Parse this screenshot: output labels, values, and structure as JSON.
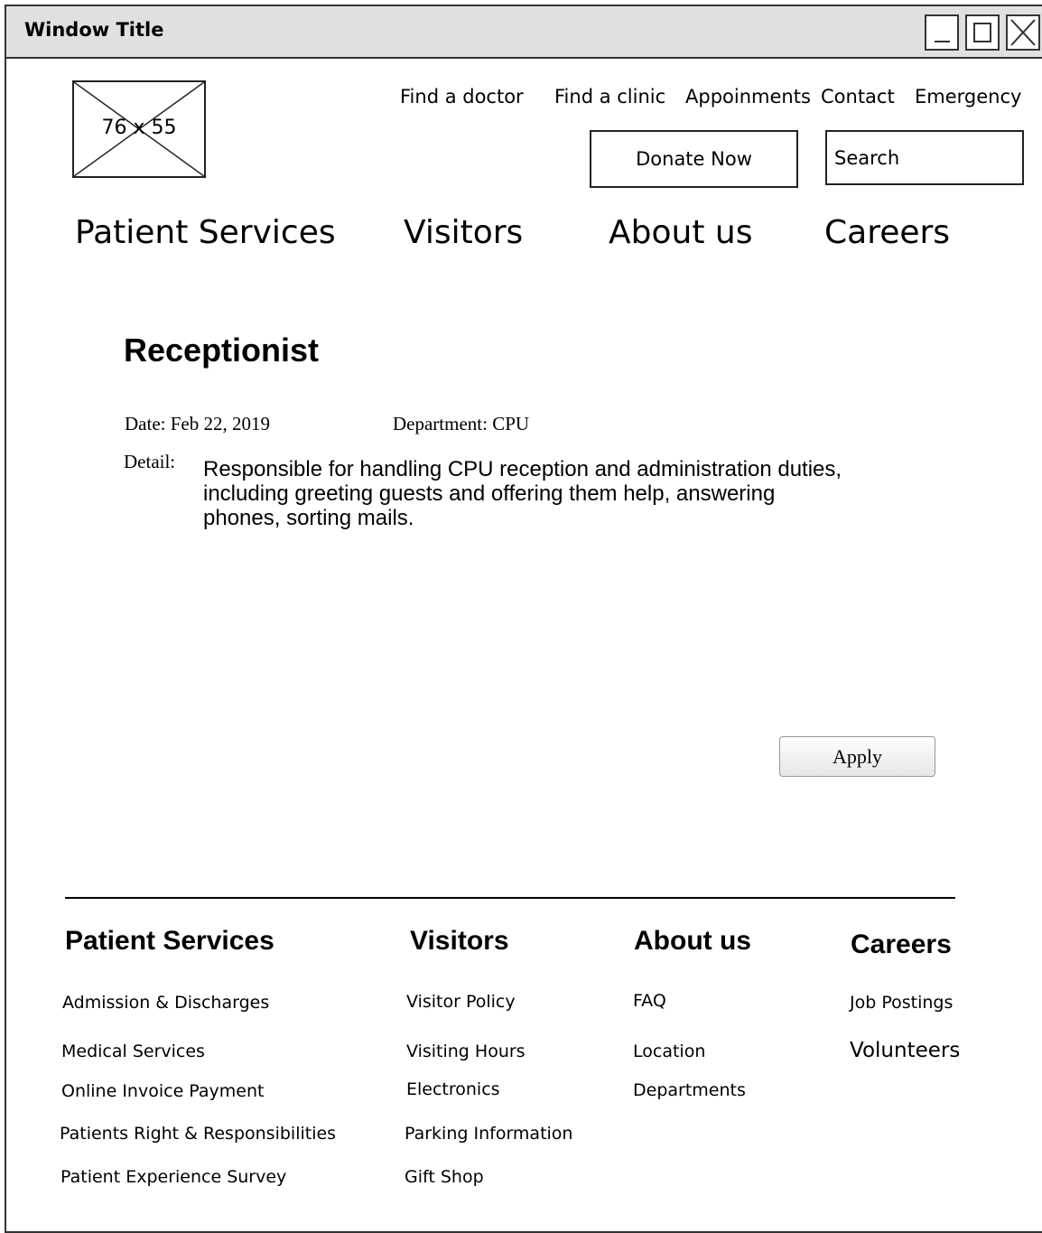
{
  "window": {
    "title": "Window Title",
    "controls": [
      "minimize-icon",
      "maximize-icon",
      "close-icon"
    ]
  },
  "logo": {
    "label": "76 x 55"
  },
  "top_links": [
    "Find a doctor",
    "Find a clinic",
    "Appoinments",
    "Contact",
    "Emergency"
  ],
  "donate": {
    "label": "Donate Now"
  },
  "search": {
    "placeholder": "Search"
  },
  "main_nav": [
    "Patient Services",
    "Visitors",
    "About us",
    "Careers"
  ],
  "job": {
    "title": "Receptionist",
    "date": "Date: Feb 22, 2019",
    "department": "Department: CPU",
    "detail_label": "Detail:",
    "detail_lines": [
      "Responsible for handling CPU reception and administration duties,",
      "including greeting guests and offering them help, answering",
      "phones, sorting mails."
    ],
    "apply_label": "Apply"
  },
  "footer": {
    "columns": [
      {
        "heading": "Patient Services",
        "links": [
          "Admission & Discharges",
          "Medical Services",
          "Online Invoice Payment",
          "Patients Right & Responsibilities",
          "Patient Experience Survey"
        ]
      },
      {
        "heading": "Visitors",
        "links": [
          "Visitor Policy",
          "Visiting Hours",
          "Electronics",
          "Parking Information",
          "Gift Shop"
        ]
      },
      {
        "heading": "About us",
        "links": [
          "FAQ",
          "Location",
          "Departments"
        ]
      },
      {
        "heading": "Careers",
        "links": [
          "Job Postings",
          "Volunteers"
        ]
      }
    ]
  }
}
